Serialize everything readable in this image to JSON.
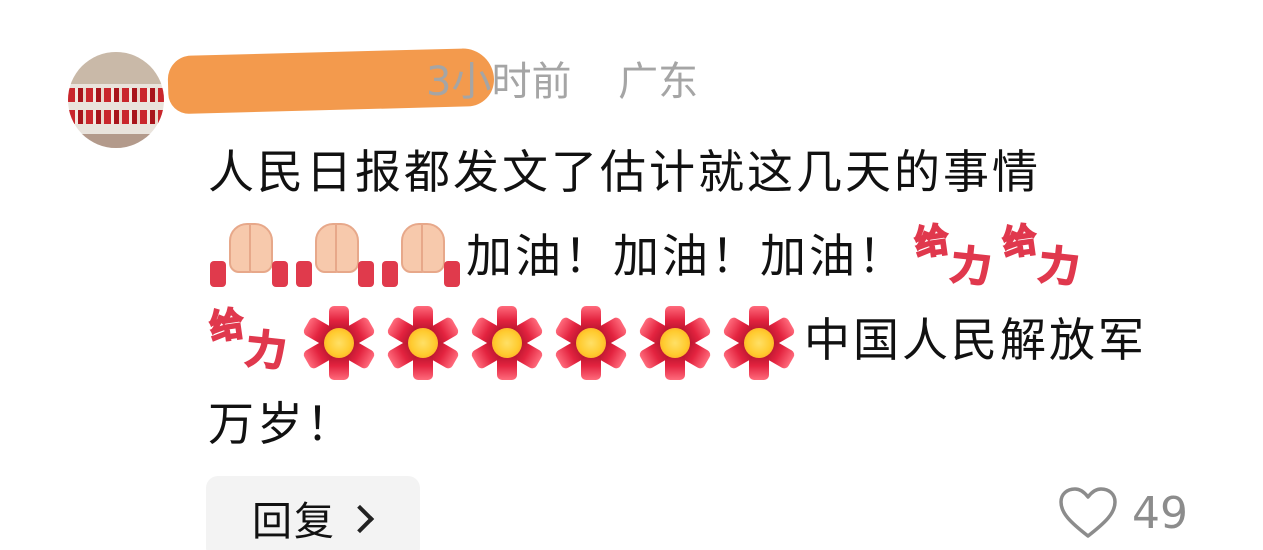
{
  "comment": {
    "time": "3小时前",
    "location": "广东",
    "text_line1": "人民日报都发文了估计就这几天的事情",
    "cheer_1": "加油！",
    "cheer_2": "加油！",
    "cheer_3": "加油！",
    "text_tail": "中国人民解放军",
    "text_line4": "万岁！",
    "emojis": {
      "pray": "praying-hands-emoji",
      "geili": "给力",
      "firecracker": "firecracker-emoji"
    }
  },
  "actions": {
    "reply_label": "回复",
    "like_count": "49"
  }
}
